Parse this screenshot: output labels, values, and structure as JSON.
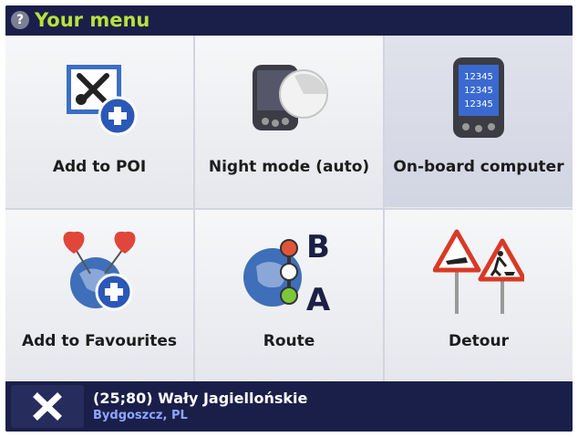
{
  "header": {
    "title": "Your menu",
    "help_glyph": "?"
  },
  "menu": {
    "items": [
      {
        "label": "Add to POI",
        "icon": "add-to-poi-icon"
      },
      {
        "label": "Night mode (auto)",
        "icon": "night-mode-device-icon"
      },
      {
        "label": "On-board computer",
        "icon": "on-board-computer-icon",
        "screen_lines": [
          "12345",
          "12345",
          "12345"
        ]
      },
      {
        "label": "Add to Favourites",
        "icon": "add-to-favourites-icon"
      },
      {
        "label": "Route",
        "icon": "route-icon",
        "point_labels": [
          "B",
          "A"
        ]
      },
      {
        "label": "Detour",
        "icon": "detour-warning-signs-icon"
      }
    ],
    "selected_index": 2
  },
  "footer": {
    "close_icon": "close-icon",
    "address": "(25;80) Wały Jagiellońskie",
    "city": "Bydgoszcz, PL"
  },
  "colors": {
    "header_bg": "#1a1f4a",
    "title": "#b8e23a",
    "city": "#8fa6ff",
    "selected_cell": "#d7d9e6"
  }
}
